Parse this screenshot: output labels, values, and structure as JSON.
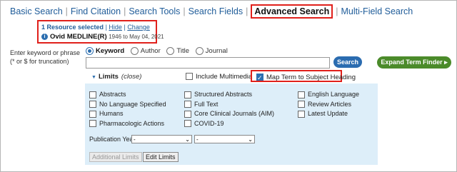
{
  "nav": {
    "items": [
      "Basic Search",
      "Find Citation",
      "Search Tools",
      "Search Fields",
      "Advanced Search",
      "Multi-Field Search"
    ],
    "separator": "|"
  },
  "resources": {
    "count_label": "1 Resource selected",
    "hide": "Hide",
    "change": "Change",
    "separator": "|",
    "db_name": "Ovid MEDLINE(R)",
    "db_dates": "1946 to May 04, 2021",
    "info_icon": "info-icon"
  },
  "search": {
    "instruction_line1": "Enter keyword or phrase",
    "instruction_line2": "(* or $ for truncation)",
    "options": [
      "Keyword",
      "Author",
      "Title",
      "Journal"
    ],
    "selected_option": "Keyword",
    "input_value": "",
    "search_button": "Search",
    "expand_button": "Expand Term Finder ▸"
  },
  "limits": {
    "title": "Limits",
    "close": "(close)",
    "include_multimedia": "Include Multimedia",
    "map_term": "Map Term to Subject Heading",
    "map_term_checked": true,
    "col1": [
      "Abstracts",
      "No Language Specified",
      "Humans",
      "Pharmacologic Actions"
    ],
    "col2": [
      "Structured Abstracts",
      "Full Text",
      "Core Clinical Journals (AIM)",
      "COVID-19"
    ],
    "col3": [
      "English Language",
      "Review Articles",
      "Latest Update"
    ],
    "pub_year_label": "Publication Year",
    "pub_from": "-",
    "pub_to": "-",
    "additional_limits": "Additional Limits",
    "edit_limits": "Edit Limits"
  },
  "colors": {
    "link": "#1f5c99",
    "highlight": "#e0201b",
    "search_btn": "#2b6cb0",
    "expand_btn": "#4b8b2a",
    "panel": "#ddeef9"
  }
}
